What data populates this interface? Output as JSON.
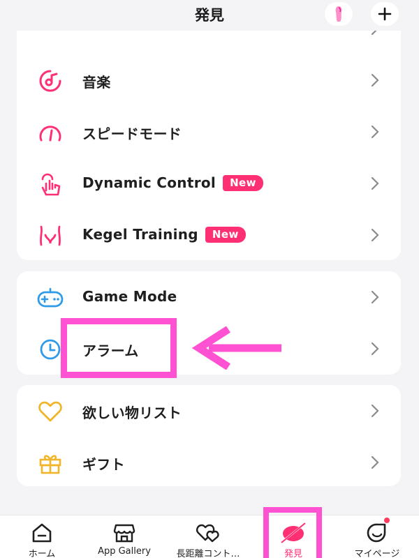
{
  "header": {
    "title": "発見"
  },
  "card1": {
    "items": [
      {
        "label": "音楽",
        "icon": "music-disc-icon",
        "badge": ""
      },
      {
        "label": "スピードモード",
        "icon": "speedometer-icon",
        "badge": ""
      },
      {
        "label": "Dynamic Control",
        "icon": "hand-touch-icon",
        "badge": "New"
      },
      {
        "label": "Kegel Training",
        "icon": "pelvis-icon",
        "badge": "New"
      }
    ]
  },
  "card2": {
    "items": [
      {
        "label": "Game Mode",
        "icon": "gamepad-icon"
      },
      {
        "label": "アラーム",
        "icon": "clock-icon"
      }
    ]
  },
  "card3": {
    "items": [
      {
        "label": "欲しい物リスト",
        "icon": "heart-icon"
      },
      {
        "label": "ギフト",
        "icon": "gift-icon"
      }
    ]
  },
  "tabbar": {
    "tabs": [
      {
        "label": "ホーム",
        "icon": "home-icon",
        "active": false
      },
      {
        "label": "App Gallery",
        "icon": "store-icon",
        "active": false
      },
      {
        "label": "長距離コント…",
        "icon": "long-distance-hearts-icon",
        "active": false
      },
      {
        "label": "発見",
        "icon": "discover-icon",
        "active": true
      },
      {
        "label": "マイページ",
        "icon": "profile-icon",
        "active": false
      }
    ]
  },
  "colors": {
    "accent": "#ff2f74",
    "blue_icon": "#2f9be8",
    "gold_icon": "#f1b52a",
    "annotation": "#ff52d2"
  }
}
